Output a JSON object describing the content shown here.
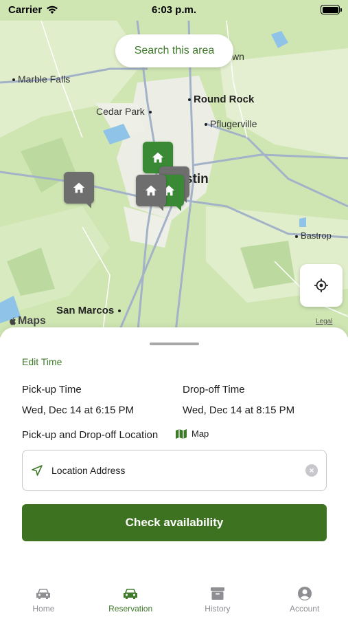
{
  "status_bar": {
    "carrier": "Carrier",
    "time": "6:03 p.m."
  },
  "map": {
    "search_button": "Search this area",
    "labels": {
      "marble_falls": "Marble Falls",
      "cedar_park": "Cedar Park",
      "round_rock": "Round Rock",
      "pflugerville": "Pflugerville",
      "austin": "stin",
      "bastrop": "Bastrop",
      "san_marcos": "San Marcos",
      "town": "wn"
    },
    "attribution": "Maps",
    "legal": "Legal",
    "pins": [
      {
        "name": "location-pin-1",
        "status": "available",
        "color": "#3a8a35"
      },
      {
        "name": "location-pin-2",
        "status": "unavailable",
        "color": "#6e6e6e"
      },
      {
        "name": "location-pin-3",
        "status": "unavailable",
        "color": "#6e6e6e"
      },
      {
        "name": "location-pin-4",
        "status": "unavailable",
        "color": "#6e6e6e"
      },
      {
        "name": "location-pin-5",
        "status": "available",
        "color": "#3a8a35"
      }
    ]
  },
  "sheet": {
    "edit_time": "Edit Time",
    "pickup_label": "Pick-up Time",
    "pickup_value": "Wed, Dec 14 at 6:15 PM",
    "dropoff_label": "Drop-off Time",
    "dropoff_value": "Wed, Dec 14 at 8:15 PM",
    "location_label": "Pick-up and Drop-off Location",
    "map_link": "Map",
    "address_placeholder": "Location Address",
    "check_button": "Check availability"
  },
  "tabbar": {
    "tabs": [
      {
        "label": "Home",
        "icon": "car-icon",
        "active": false
      },
      {
        "label": "Reservation",
        "icon": "car-icon",
        "active": true
      },
      {
        "label": "History",
        "icon": "archive-box-icon",
        "active": false
      },
      {
        "label": "Account",
        "icon": "person-circle-icon",
        "active": false
      }
    ]
  },
  "colors": {
    "accent": "#3e7a29",
    "button": "#3d7320",
    "map_bg": "#cfe6b3"
  }
}
